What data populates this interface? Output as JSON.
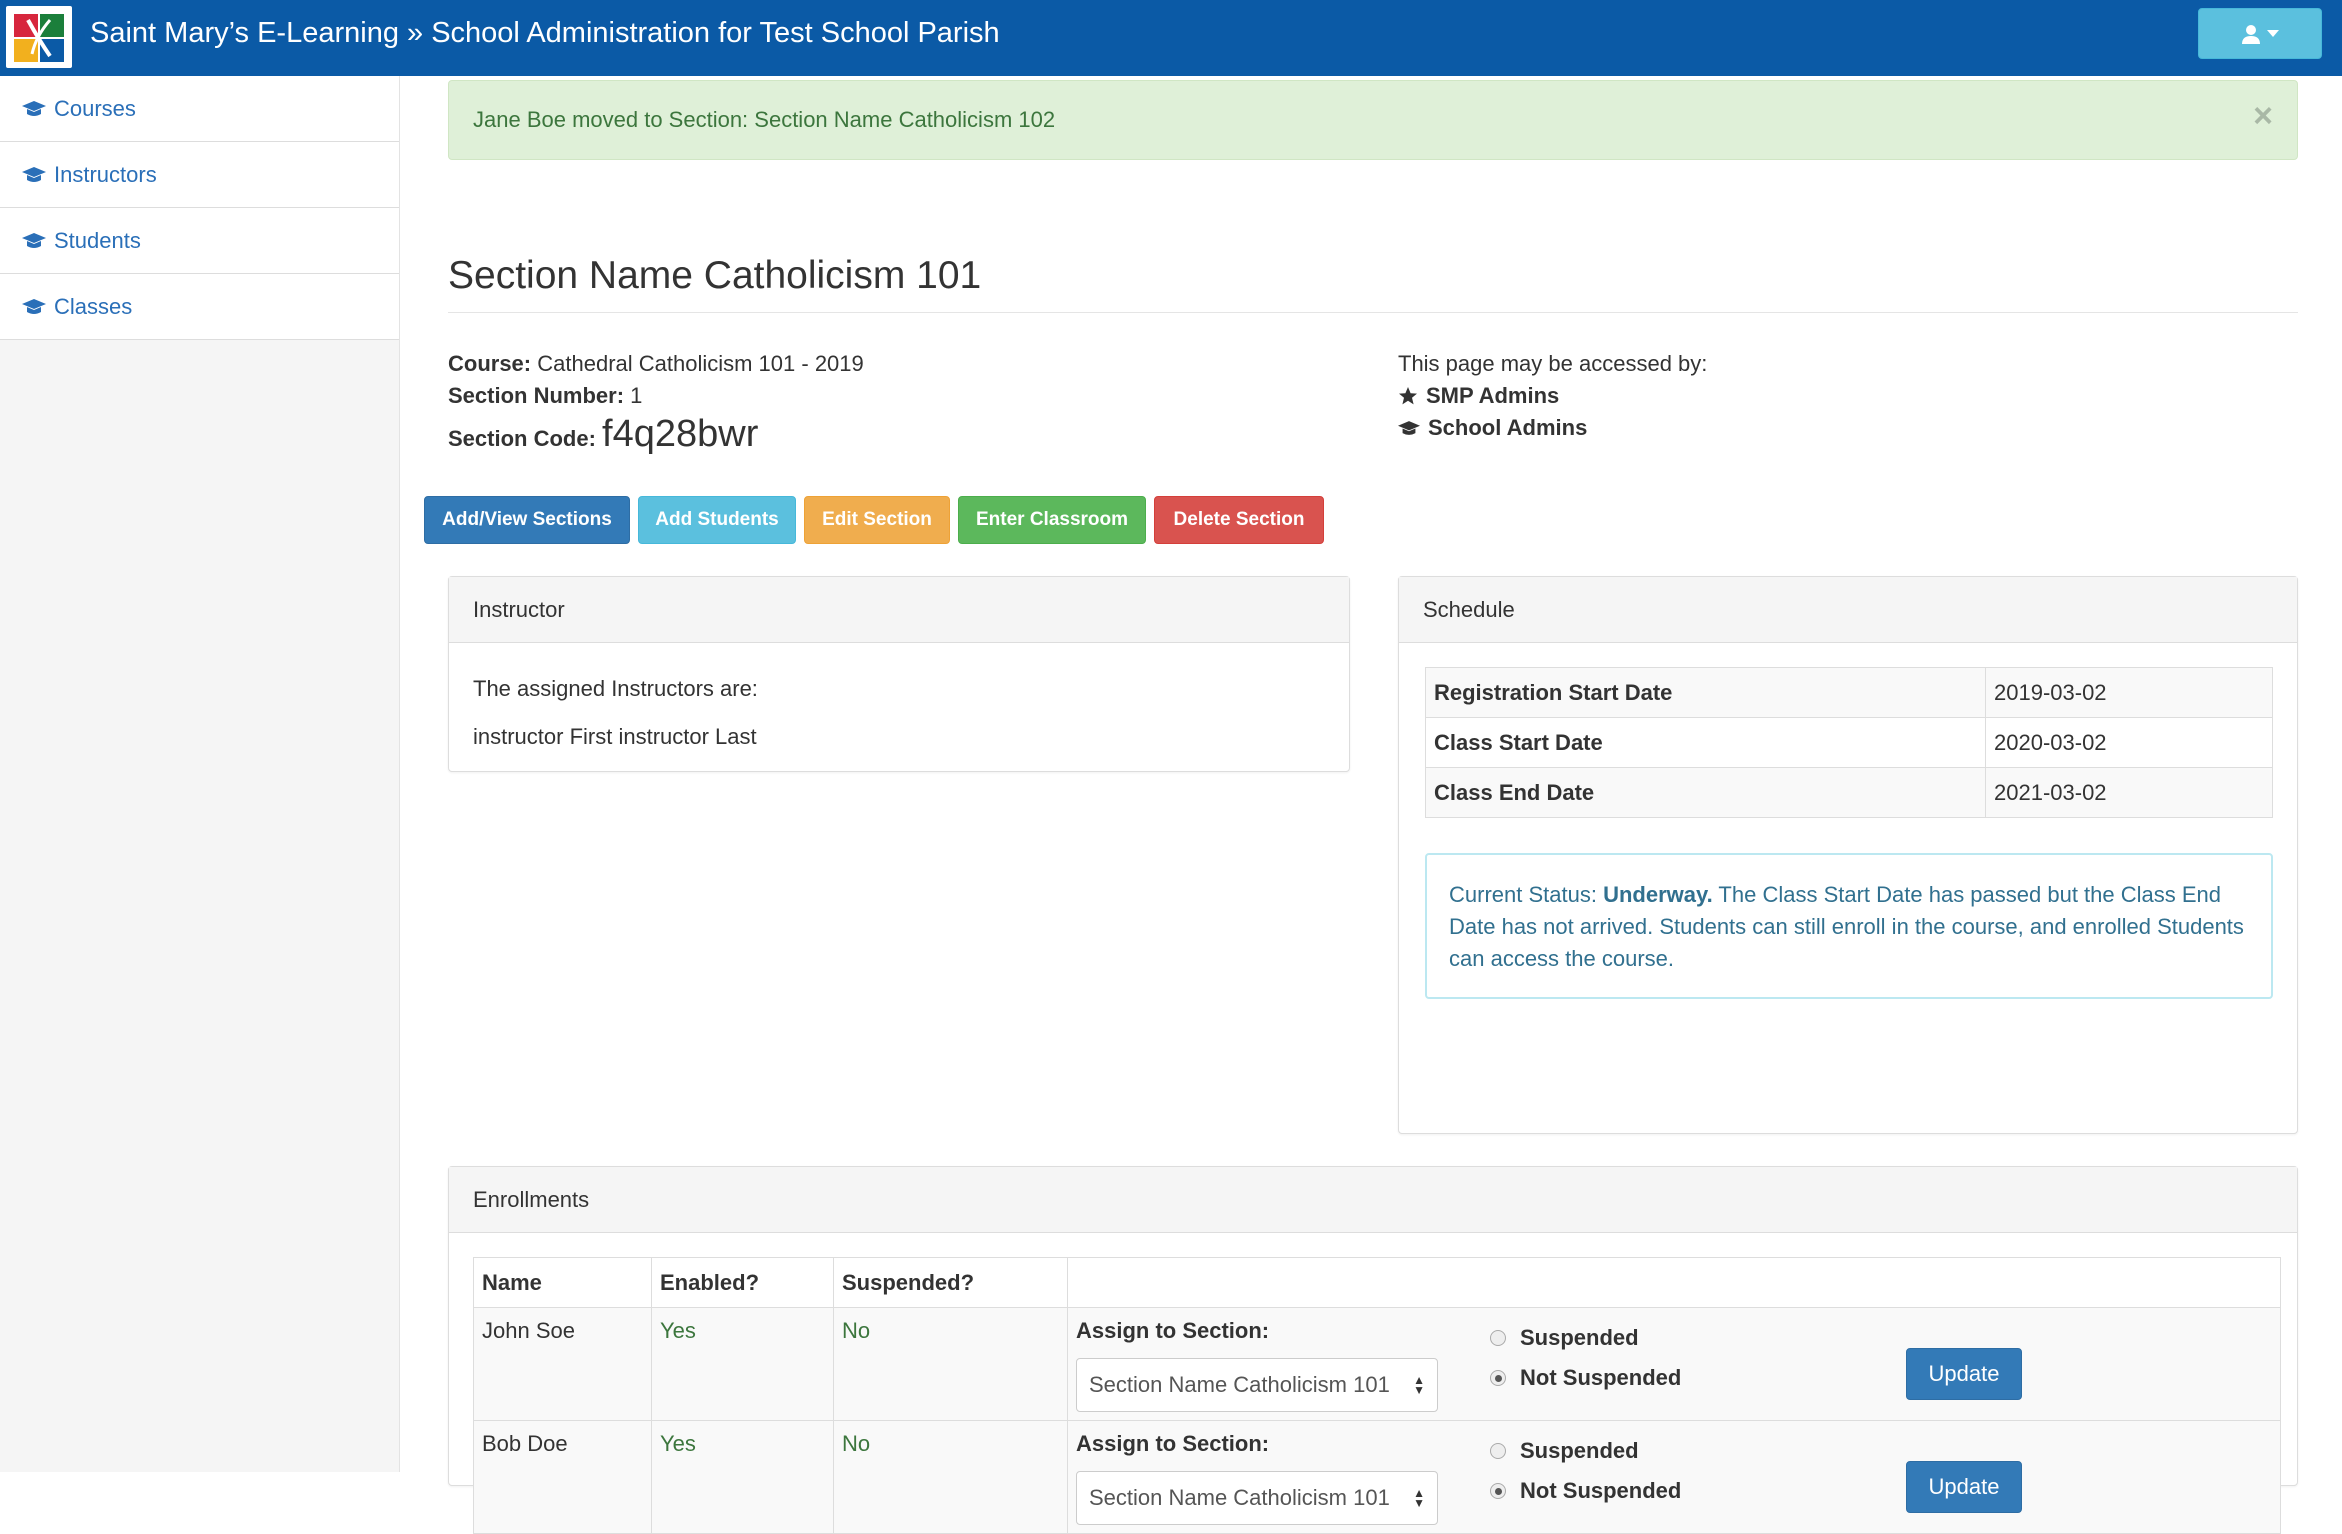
{
  "navbar": {
    "brand": "Saint Mary’s E-Learning » School Administration for Test School Parish",
    "user_icon": "user-icon",
    "caret_icon": "caret-down-icon"
  },
  "sidebar": {
    "items": [
      {
        "label": "Courses",
        "icon": "graduation-cap-icon"
      },
      {
        "label": "Instructors",
        "icon": "graduation-cap-icon"
      },
      {
        "label": "Students",
        "icon": "graduation-cap-icon"
      },
      {
        "label": "Classes",
        "icon": "graduation-cap-icon"
      }
    ]
  },
  "alert": {
    "message": "Jane Boe moved to Section: Section Name Catholicism 102",
    "close": "×"
  },
  "page": {
    "title": "Section Name Catholicism 101",
    "course_label": "Course:",
    "course_value": "Cathedral Catholicism 101 - 2019",
    "section_number_label": "Section Number:",
    "section_number_value": "1",
    "section_code_label": "Section Code:",
    "section_code_value": "f4q28bwr",
    "access_text": "This page may be accessed by:",
    "access_roles": [
      {
        "label": "SMP Admins",
        "icon": "star-icon"
      },
      {
        "label": "School Admins",
        "icon": "graduation-cap-icon"
      }
    ]
  },
  "buttons": {
    "add_view_sections": "Add/View Sections",
    "add_students": "Add Students",
    "edit_section": "Edit Section",
    "enter_classroom": "Enter Classroom",
    "delete_section": "Delete Section"
  },
  "instructor_panel": {
    "title": "Instructor",
    "intro": "The assigned Instructors are:",
    "instructors": [
      "instructor First instructor Last"
    ]
  },
  "schedule_panel": {
    "title": "Schedule",
    "rows": [
      {
        "label": "Registration Start Date",
        "value": "2019-03-02"
      },
      {
        "label": "Class Start Date",
        "value": "2020-03-02"
      },
      {
        "label": "Class End Date",
        "value": "2021-03-02"
      }
    ],
    "status_prefix": "Current Status:",
    "status_value": "Underway.",
    "status_text": "The Class Start Date has passed but the Class End Date has not arrived. Students can still enroll in the course, and enrolled Students can access the course."
  },
  "enrollments_panel": {
    "title": "Enrollments",
    "headers": [
      "Name",
      "Enabled?",
      "Suspended?",
      ""
    ],
    "assign_label": "Assign to Section:",
    "suspended_label": "Suspended",
    "not_suspended_label": "Not Suspended",
    "update_label": "Update",
    "rows": [
      {
        "name": "John Soe",
        "enabled": "Yes",
        "suspended": "No",
        "section": "Section Name Catholicism 101",
        "status": "Not Suspended"
      },
      {
        "name": "Bob Doe",
        "enabled": "Yes",
        "suspended": "No",
        "section": "Section Name Catholicism 101",
        "status": "Not Suspended"
      }
    ]
  }
}
